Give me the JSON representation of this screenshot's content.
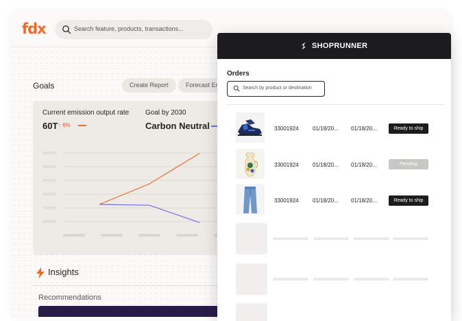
{
  "app": {
    "logo": "fdx",
    "search_placeholder": "Search feature, products, transactions..."
  },
  "goals": {
    "title": "Goals",
    "buttons": [
      "Create Report",
      "Forecast Em"
    ],
    "current_label": "Current emission output rate",
    "current_value": "60T",
    "current_delta": "6%",
    "goal_label": "Goal by 2030",
    "goal_value": "Carbon Neutral",
    "colors": {
      "emission": "#ee6a2b",
      "goal": "#6b6ee8"
    }
  },
  "chart_data": {
    "type": "line",
    "title": "",
    "xlabel": "",
    "ylabel": "",
    "series": [
      {
        "values": [
          0,
          0.25,
          0.62
        ]
      },
      {
        "values": [
          0,
          -0.01,
          -0.22
        ]
      }
    ]
  },
  "insights": {
    "title": "Insights",
    "recommendations_label": "Recommendations"
  },
  "shoprunner": {
    "brand": "SHOPRUNNER",
    "orders_title": "Orders",
    "search_placeholder": "Search by product or destination",
    "orders": [
      {
        "product": "sneakers",
        "id": "33001924",
        "date1": "01/18/20...",
        "date2": "01/18/20...",
        "status": "Ready to ship",
        "status_style": "dark"
      },
      {
        "product": "vase",
        "id": "33001924",
        "date1": "01/18/20...",
        "date2": "01/18/20...",
        "status": "Pending",
        "status_style": "grey"
      },
      {
        "product": "jeans",
        "id": "33001924",
        "date1": "01/18/20...",
        "date2": "01/18/20...",
        "status": "Ready to ship",
        "status_style": "dark"
      }
    ]
  }
}
